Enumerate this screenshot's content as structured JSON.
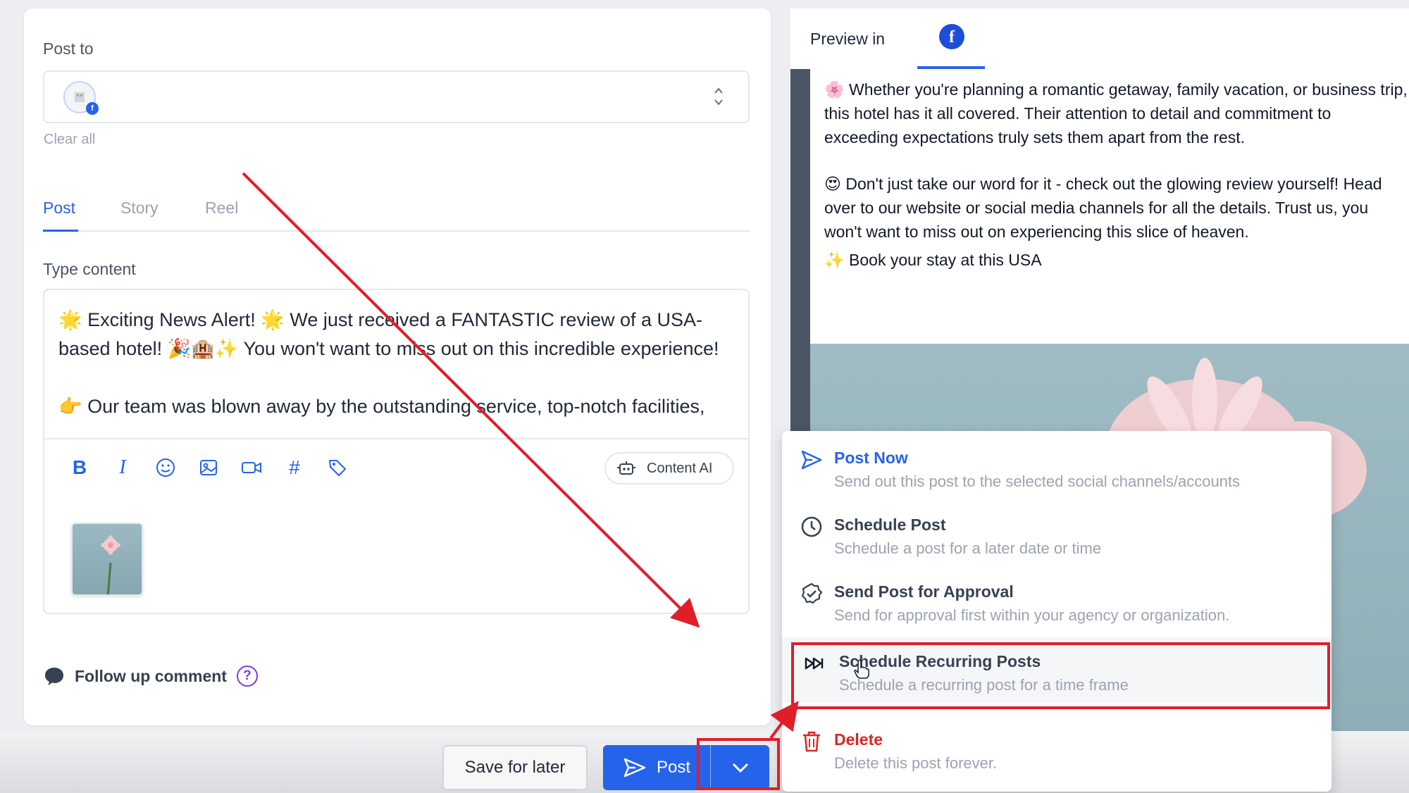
{
  "composer": {
    "post_to_label": "Post to",
    "clear_all": "Clear all",
    "tabs": [
      {
        "label": "Post",
        "active": true
      },
      {
        "label": "Story",
        "active": false
      },
      {
        "label": "Reel",
        "active": false
      }
    ],
    "type_content_label": "Type content",
    "content_text": "🌟 Exciting News Alert! 🌟 We just received a FANTASTIC review of a USA-based hotel! 🎉🏨✨ You won't want to miss out on this incredible experience!\n\n👉 Our team was blown away by the outstanding service, top-notch facilities,",
    "toolbar_icons": [
      "bold-icon",
      "italic-icon",
      "emoji-icon",
      "image-icon",
      "video-icon",
      "hashtag-icon",
      "tag-icon"
    ],
    "content_ai_label": "Content AI",
    "follow_up_label": "Follow up comment",
    "help_glyph": "?"
  },
  "actions": {
    "save_for_later": "Save for later",
    "post": "Post"
  },
  "preview": {
    "preview_in_label": "Preview in",
    "platform_glyph": "f",
    "paragraphs": [
      "🌸 Whether you're planning a romantic getaway, family vacation, or business trip, this hotel has it all covered. Their attention to detail and commitment to exceeding expectations truly sets them apart from the rest.",
      "😍 Don't just take our word for it - check out the glowing review yourself! Head over to our website or social media channels for all the details. Trust us, you won't want to miss out on experiencing this slice of heaven.",
      "✨ Book your stay at this USA"
    ]
  },
  "post_menu": {
    "items": [
      {
        "title": "Post Now",
        "description": "Send out this post to the selected social channels/accounts",
        "icon": "send-icon"
      },
      {
        "title": "Schedule Post",
        "description": "Schedule a post for a later date or time",
        "icon": "clock-icon"
      },
      {
        "title": "Send Post for Approval",
        "description": "Send for approval first within your agency or organization.",
        "icon": "approval-badge-icon"
      },
      {
        "title": "Schedule Recurring Posts",
        "description": "Schedule a recurring post for a time frame",
        "icon": "fast-forward-icon"
      },
      {
        "title": "Delete",
        "description": "Delete this post forever.",
        "icon": "trash-icon"
      }
    ]
  },
  "colors": {
    "accent": "#2563eb",
    "danger": "#dc2626",
    "annotation": "#e11d2a"
  }
}
